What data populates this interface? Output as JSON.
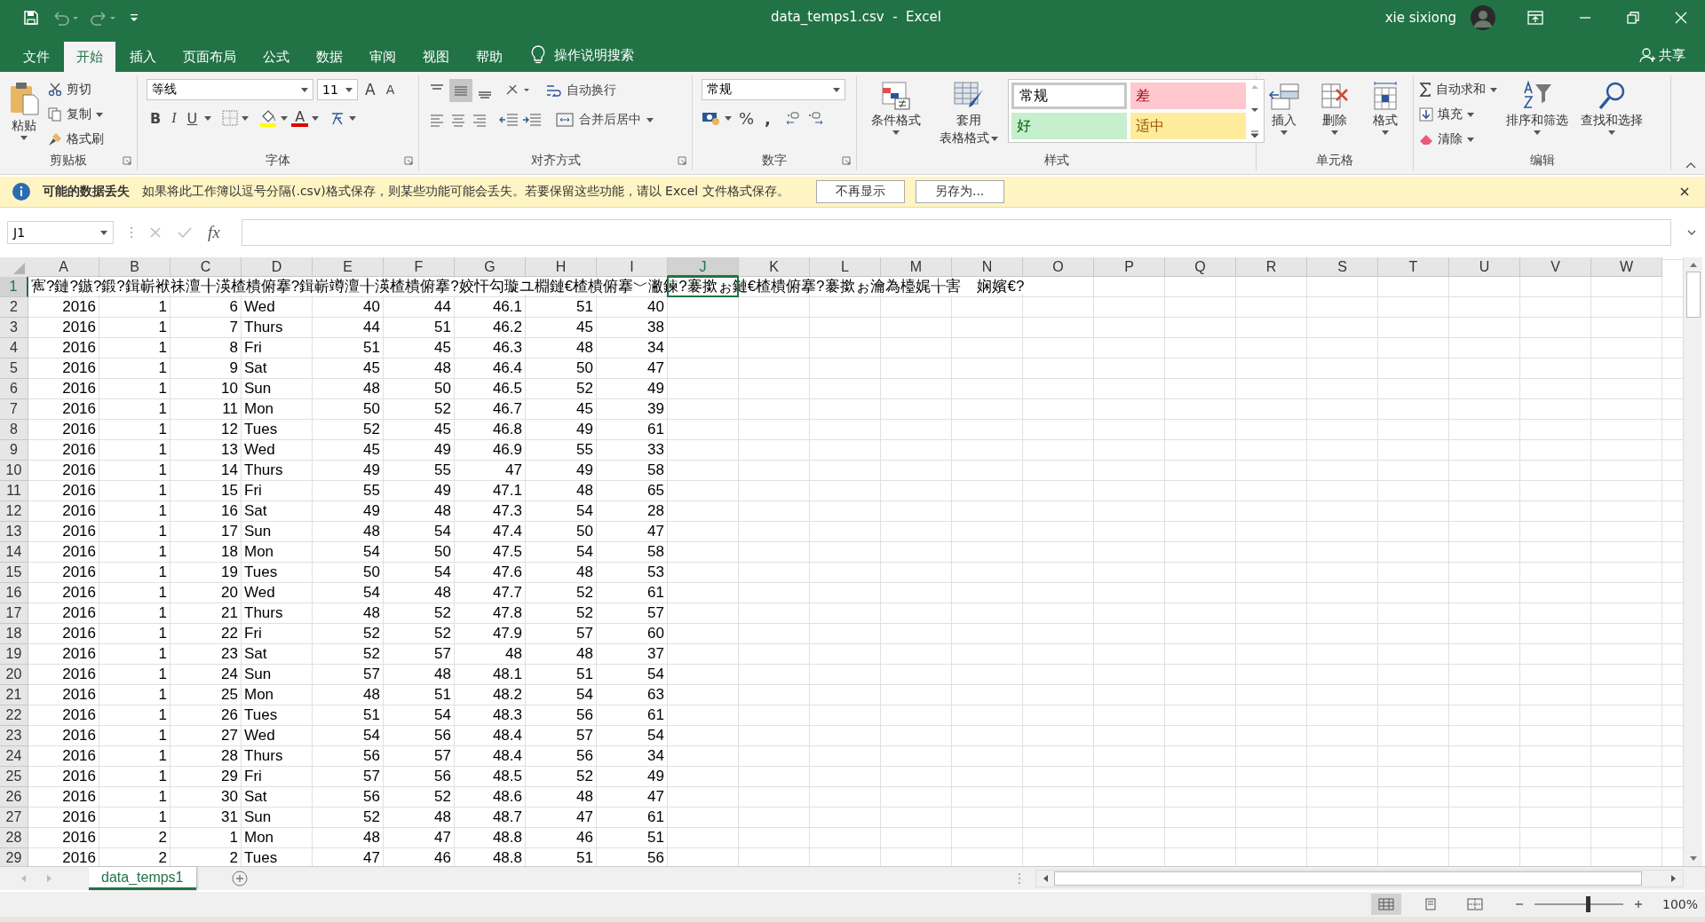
{
  "title_bar": {
    "title": "data_temps1.csv  -  Excel",
    "user": "xie sixiong"
  },
  "tabs": [
    {
      "label": "文件",
      "selected": false
    },
    {
      "label": "开始",
      "selected": true
    },
    {
      "label": "插入",
      "selected": false
    },
    {
      "label": "页面布局",
      "selected": false
    },
    {
      "label": "公式",
      "selected": false
    },
    {
      "label": "数据",
      "selected": false
    },
    {
      "label": "审阅",
      "selected": false
    },
    {
      "label": "视图",
      "selected": false
    },
    {
      "label": "帮助",
      "selected": false
    }
  ],
  "tell_me": "操作说明搜索",
  "share": "共享",
  "ribbon": {
    "clipboard": {
      "title": "剪贴板",
      "paste": "粘贴",
      "cut": "剪切",
      "copy": "复制",
      "format_painter": "格式刷"
    },
    "font": {
      "title": "字体",
      "font_name": "等线",
      "font_size": "11",
      "grow": "A",
      "shrink": "A",
      "bold": "B",
      "italic": "I",
      "underline": "U",
      "font_color": "A"
    },
    "alignment": {
      "title": "对齐方式",
      "wrap": "自动换行",
      "merge": "合并后居中"
    },
    "number": {
      "title": "数字",
      "format": "常规",
      "percent": "%",
      "comma": ","
    },
    "styles": {
      "title": "样式",
      "conditional": "条件格式",
      "table_format": [
        "套用",
        "表格格式"
      ],
      "cell_styles": [
        {
          "label": "常规",
          "kind": "normal"
        },
        {
          "label": "差",
          "kind": "bad"
        },
        {
          "label": "好",
          "kind": "good"
        },
        {
          "label": "适中",
          "kind": "neutral"
        }
      ]
    },
    "cells": {
      "title": "单元格",
      "insert": "插入",
      "delete": "删除",
      "format": "格式"
    },
    "editing": {
      "title": "编辑",
      "autosum": "自动求和",
      "fill": "填充",
      "clear": "清除",
      "sort": "排序和筛选",
      "find": "查找和选择"
    }
  },
  "info_bar": {
    "title": "可能的数据丢失",
    "message": "如果将此工作簿以逗号分隔(.csv)格式保存，则某些功能可能会丢失。若要保留这些功能，请以 Excel 文件格式保存。",
    "buttons": [
      "不再显示",
      "另存为..."
    ]
  },
  "formula_bar": {
    "name_box": "J1",
    "function_label": "fx"
  },
  "sheet": {
    "columns": [
      {
        "label": "A",
        "selected": false
      },
      {
        "label": "B",
        "selected": false
      },
      {
        "label": "C",
        "selected": false
      },
      {
        "label": "D",
        "selected": false
      },
      {
        "label": "E",
        "selected": false
      },
      {
        "label": "F",
        "selected": false
      },
      {
        "label": "G",
        "selected": false
      },
      {
        "label": "H",
        "selected": false
      },
      {
        "label": "I",
        "selected": false
      },
      {
        "label": "J",
        "selected": true
      },
      {
        "label": "K",
        "selected": false
      },
      {
        "label": "L",
        "selected": false
      },
      {
        "label": "M",
        "selected": false
      },
      {
        "label": "N",
        "selected": false
      },
      {
        "label": "O",
        "selected": false
      },
      {
        "label": "P",
        "selected": false
      },
      {
        "label": "Q",
        "selected": false
      },
      {
        "label": "R",
        "selected": false
      },
      {
        "label": "S",
        "selected": false
      },
      {
        "label": "T",
        "selected": false
      },
      {
        "label": "U",
        "selected": false
      },
      {
        "label": "V",
        "selected": false
      },
      {
        "label": "W",
        "selected": false
      }
    ],
    "rows": [
      {
        "number": "1",
        "selected": true,
        "cells": [
          "寯?鏈?鏃?鍛?鍓嶄袱祙澶╂渶楂樻俯搴?鍓嶄竴澶╂渶楂樻俯搴?姣忓勾璇ユ棩鏈€楂樻俯搴﹀潎鍊?褰撳ぉ鏈€楂樻俯搴?褰撳ぉ瀹為檯娓╁害    娴嬪€?"
        ]
      },
      {
        "number": "2",
        "selected": false,
        "cells": [
          "2016",
          "1",
          "6",
          "Wed",
          "40",
          "44",
          "46.1",
          "51",
          "40"
        ]
      },
      {
        "number": "3",
        "selected": false,
        "cells": [
          "2016",
          "1",
          "7",
          "Thurs",
          "44",
          "51",
          "46.2",
          "45",
          "38"
        ]
      },
      {
        "number": "4",
        "selected": false,
        "cells": [
          "2016",
          "1",
          "8",
          "Fri",
          "51",
          "45",
          "46.3",
          "48",
          "34"
        ]
      },
      {
        "number": "5",
        "selected": false,
        "cells": [
          "2016",
          "1",
          "9",
          "Sat",
          "45",
          "48",
          "46.4",
          "50",
          "47"
        ]
      },
      {
        "number": "6",
        "selected": false,
        "cells": [
          "2016",
          "1",
          "10",
          "Sun",
          "48",
          "50",
          "46.5",
          "52",
          "49"
        ]
      },
      {
        "number": "7",
        "selected": false,
        "cells": [
          "2016",
          "1",
          "11",
          "Mon",
          "50",
          "52",
          "46.7",
          "45",
          "39"
        ]
      },
      {
        "number": "8",
        "selected": false,
        "cells": [
          "2016",
          "1",
          "12",
          "Tues",
          "52",
          "45",
          "46.8",
          "49",
          "61"
        ]
      },
      {
        "number": "9",
        "selected": false,
        "cells": [
          "2016",
          "1",
          "13",
          "Wed",
          "45",
          "49",
          "46.9",
          "55",
          "33"
        ]
      },
      {
        "number": "10",
        "selected": false,
        "cells": [
          "2016",
          "1",
          "14",
          "Thurs",
          "49",
          "55",
          "47",
          "49",
          "58"
        ]
      },
      {
        "number": "11",
        "selected": false,
        "cells": [
          "2016",
          "1",
          "15",
          "Fri",
          "55",
          "49",
          "47.1",
          "48",
          "65"
        ]
      },
      {
        "number": "12",
        "selected": false,
        "cells": [
          "2016",
          "1",
          "16",
          "Sat",
          "49",
          "48",
          "47.3",
          "54",
          "28"
        ]
      },
      {
        "number": "13",
        "selected": false,
        "cells": [
          "2016",
          "1",
          "17",
          "Sun",
          "48",
          "54",
          "47.4",
          "50",
          "47"
        ]
      },
      {
        "number": "14",
        "selected": false,
        "cells": [
          "2016",
          "1",
          "18",
          "Mon",
          "54",
          "50",
          "47.5",
          "54",
          "58"
        ]
      },
      {
        "number": "15",
        "selected": false,
        "cells": [
          "2016",
          "1",
          "19",
          "Tues",
          "50",
          "54",
          "47.6",
          "48",
          "53"
        ]
      },
      {
        "number": "16",
        "selected": false,
        "cells": [
          "2016",
          "1",
          "20",
          "Wed",
          "54",
          "48",
          "47.7",
          "52",
          "61"
        ]
      },
      {
        "number": "17",
        "selected": false,
        "cells": [
          "2016",
          "1",
          "21",
          "Thurs",
          "48",
          "52",
          "47.8",
          "52",
          "57"
        ]
      },
      {
        "number": "18",
        "selected": false,
        "cells": [
          "2016",
          "1",
          "22",
          "Fri",
          "52",
          "52",
          "47.9",
          "57",
          "60"
        ]
      },
      {
        "number": "19",
        "selected": false,
        "cells": [
          "2016",
          "1",
          "23",
          "Sat",
          "52",
          "57",
          "48",
          "48",
          "37"
        ]
      },
      {
        "number": "20",
        "selected": false,
        "cells": [
          "2016",
          "1",
          "24",
          "Sun",
          "57",
          "48",
          "48.1",
          "51",
          "54"
        ]
      },
      {
        "number": "21",
        "selected": false,
        "cells": [
          "2016",
          "1",
          "25",
          "Mon",
          "48",
          "51",
          "48.2",
          "54",
          "63"
        ]
      },
      {
        "number": "22",
        "selected": false,
        "cells": [
          "2016",
          "1",
          "26",
          "Tues",
          "51",
          "54",
          "48.3",
          "56",
          "61"
        ]
      },
      {
        "number": "23",
        "selected": false,
        "cells": [
          "2016",
          "1",
          "27",
          "Wed",
          "54",
          "56",
          "48.4",
          "57",
          "54"
        ]
      },
      {
        "number": "24",
        "selected": false,
        "cells": [
          "2016",
          "1",
          "28",
          "Thurs",
          "56",
          "57",
          "48.4",
          "56",
          "34"
        ]
      },
      {
        "number": "25",
        "selected": false,
        "cells": [
          "2016",
          "1",
          "29",
          "Fri",
          "57",
          "56",
          "48.5",
          "52",
          "49"
        ]
      },
      {
        "number": "26",
        "selected": false,
        "cells": [
          "2016",
          "1",
          "30",
          "Sat",
          "56",
          "52",
          "48.6",
          "48",
          "47"
        ]
      },
      {
        "number": "27",
        "selected": false,
        "cells": [
          "2016",
          "1",
          "31",
          "Sun",
          "52",
          "48",
          "48.7",
          "47",
          "61"
        ]
      },
      {
        "number": "28",
        "selected": false,
        "cells": [
          "2016",
          "2",
          "1",
          "Mon",
          "48",
          "47",
          "48.8",
          "46",
          "51"
        ]
      },
      {
        "number": "29",
        "selected": false,
        "cells": [
          "2016",
          "2",
          "2",
          "Tues",
          "47",
          "46",
          "48.8",
          "51",
          "56"
        ]
      }
    ]
  },
  "sheet_tabs": [
    {
      "label": "data_temps1",
      "selected": true
    }
  ],
  "status_bar": {
    "views": [
      {
        "kind": "normal",
        "selected": true
      },
      {
        "kind": "page_layout",
        "selected": false
      },
      {
        "kind": "page_break",
        "selected": false
      }
    ],
    "zoom_slider": {
      "level": 0.6
    },
    "zoom": "100%"
  }
}
